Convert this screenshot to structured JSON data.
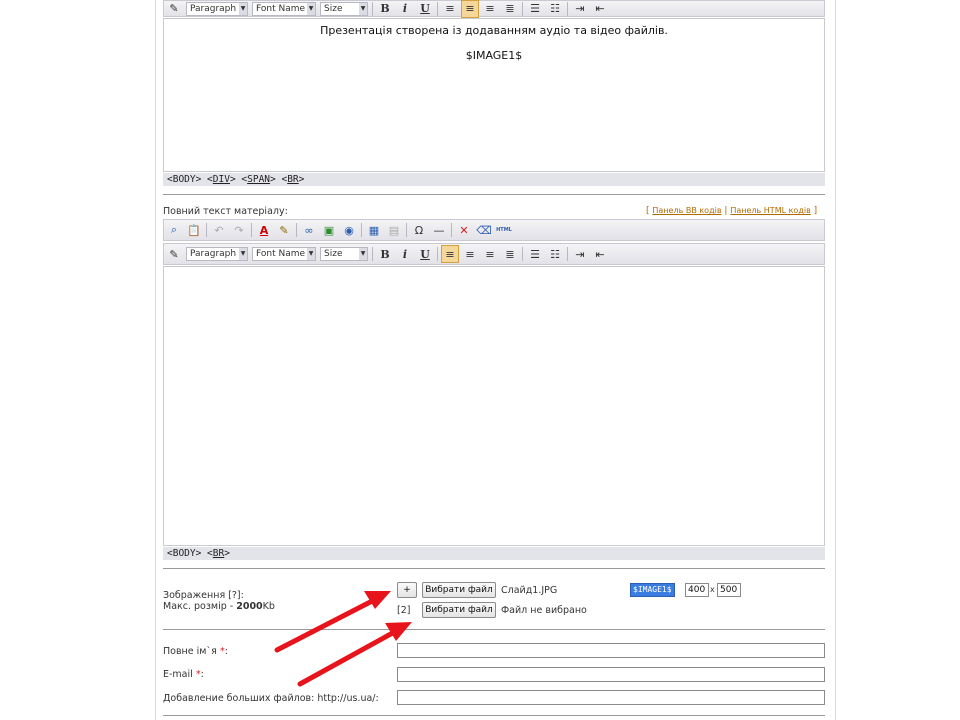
{
  "editor1": {
    "toolbar": {
      "paragraph": "Paragraph",
      "font_name": "Font Name",
      "size": "Size",
      "bold": "B",
      "italic": "i",
      "underline": "U"
    },
    "content_line1": "Презентація створена із додаванням аудіо та відео файлів.",
    "content_line2": "$IMAGE1$",
    "path": {
      "body": "<BODY>",
      "div": "DIV",
      "span": "SPAN",
      "br": "BR"
    }
  },
  "fulltext": {
    "label": "Повний текст матеріалу:",
    "links": {
      "open": "[",
      "bb": "Панель BB кодів",
      "divider": "|",
      "html": "Панель HTML кодів",
      "close": "]"
    },
    "toolbar": {
      "paragraph": "Paragraph",
      "font_name": "Font Name",
      "size": "Size",
      "bold": "B",
      "italic": "i",
      "underline": "U",
      "omega": "Ω",
      "html_label": "HTML"
    },
    "path": {
      "body": "<BODY>",
      "br": "BR"
    }
  },
  "images": {
    "label": "Зображення [?]:",
    "max_size_prefix": "Макс. розмір - ",
    "max_size_value": "2000",
    "max_size_unit": "Kb",
    "add_button": "+",
    "choose_file_1": "Вибрати файл",
    "file_1": "Слайд1.JPG",
    "tag_1": "$IMAGE1$",
    "width": "400",
    "times": "x",
    "height": "500",
    "index_2": "[2]",
    "choose_file_2": "Вибрати файл",
    "file_2": "Файл не вибрано"
  },
  "form": {
    "full_name_label": "Повне ім`я",
    "email_label": "E-mail",
    "required_mark": "*",
    "colon": ":",
    "big_files_label": "Добавление больших файлов: http://us.ua/:"
  },
  "colors": {
    "accent": "#b06a00",
    "arrow": "#e8141b",
    "highlight": "#3a7de0"
  }
}
